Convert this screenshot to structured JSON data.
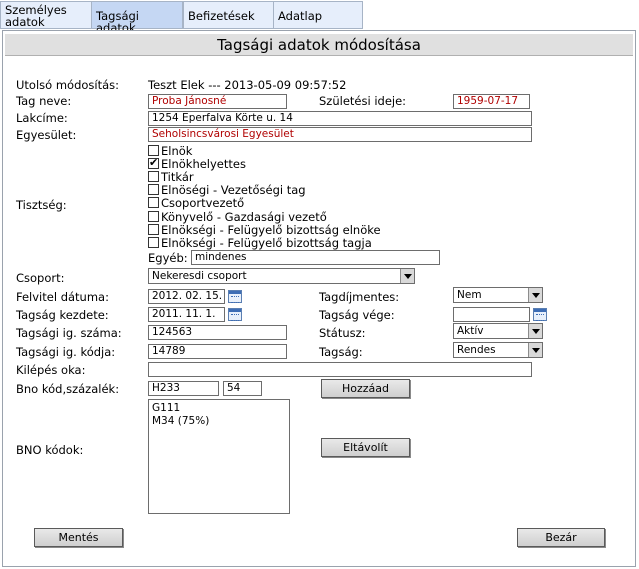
{
  "tabs": [
    {
      "label": "Személyes adatok"
    },
    {
      "label": "Tagsági adatok"
    },
    {
      "label": "Befizetések"
    },
    {
      "label": "Adatlap"
    }
  ],
  "title": "Tagsági adatok módosítása",
  "last_modified": {
    "label": "Utolsó módosítás:",
    "value": "Teszt Elek --- 2013-05-09 09:57:52"
  },
  "member_name": {
    "label": "Tag neve:",
    "value": "Proba Jánosné"
  },
  "birth_date": {
    "label": "Születési ideje:",
    "value": "1959-07-17"
  },
  "address": {
    "label": "Lakcíme:",
    "value": "1254 Eperfalva Körte u. 14"
  },
  "association": {
    "label": "Egyesület:",
    "value": "Seholsincsvárosi Egyesület"
  },
  "positions": {
    "label": "Tisztség:",
    "items": [
      {
        "label": "Elnök",
        "checked": false
      },
      {
        "label": "Elnökhelyettes",
        "checked": true
      },
      {
        "label": "Titkár",
        "checked": false
      },
      {
        "label": "Elnöségi - Vezetőségi tag",
        "checked": false
      },
      {
        "label": "Csoportvezető",
        "checked": false
      },
      {
        "label": "Könyvelő - Gazdasági vezető",
        "checked": false
      },
      {
        "label": "Elnökségi - Felügyelő bizottság elnöke",
        "checked": false
      },
      {
        "label": "Elnökségi - Felügyelő bizottság tagja",
        "checked": false
      }
    ],
    "other_label": "Egyéb:",
    "other_value": "mindenes"
  },
  "group": {
    "label": "Csoport:",
    "value": "Nekeresdi csoport"
  },
  "joined": {
    "label": "Felvitel dátuma:",
    "value": "2012. 02. 15."
  },
  "fee_exempt": {
    "label": "Tagdíjmentes:",
    "value": "Nem"
  },
  "membership_start": {
    "label": "Tagság kezdete:",
    "value": "2011. 11. 1."
  },
  "membership_end": {
    "label": "Tagság vége:",
    "value": ""
  },
  "card_number": {
    "label": "Tagsági ig. száma:",
    "value": "124563"
  },
  "status": {
    "label": "Státusz:",
    "value": "Aktív"
  },
  "card_code": {
    "label": "Tagsági ig. kódja:",
    "value": "14789"
  },
  "membership": {
    "label": "Tagság:",
    "value": "Rendes"
  },
  "exit_reason": {
    "label": "Kilépés oka:",
    "value": ""
  },
  "bno_entry": {
    "label": "Bno kód,százalék:",
    "code": "H233",
    "percent": "54",
    "add_label": "Hozzáad"
  },
  "bno_codes": {
    "label": "BNO kódok:",
    "items": [
      "G111",
      "M34 (75%)"
    ],
    "remove_label": "Eltávolít"
  },
  "save_label": "Mentés",
  "close_label": "Bezár"
}
